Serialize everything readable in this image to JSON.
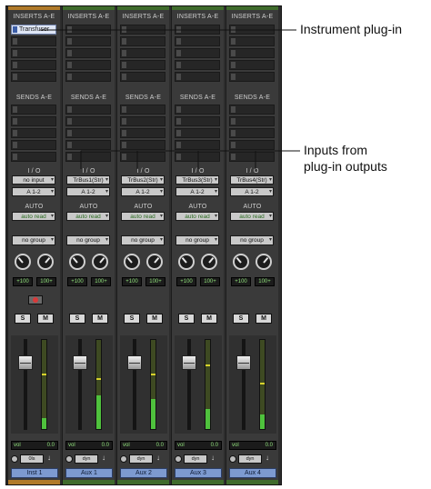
{
  "annotations": {
    "instrument": "Instrument plug-in",
    "inputs_line1": "Inputs from",
    "inputs_line2": "plug-in outputs"
  },
  "section_labels": {
    "inserts": "INSERTS A-E",
    "sends": "SENDS A-E",
    "io": "I / O",
    "auto": "AUTO",
    "vol": "vol"
  },
  "strips": [
    {
      "color": "#b07a2a",
      "insert": "Transfuser",
      "input": "no input",
      "output": "A 1-2",
      "auto": "auto read",
      "group": "no group",
      "pan_l": "+100",
      "pan_r": "100+",
      "rec": true,
      "solo": "S",
      "mute": "M",
      "vol": "0.0",
      "dyn": "0ls",
      "name": "Inst 1",
      "meter_level": 0.12,
      "peak": 0.6
    },
    {
      "color": "#3f6b2c",
      "insert": "",
      "input": "TrBus1(Str)",
      "output": "A 1-2",
      "auto": "auto read",
      "group": "no group",
      "pan_l": "+100",
      "pan_r": "100+",
      "rec": false,
      "solo": "S",
      "mute": "M",
      "vol": "0.0",
      "dyn": "dyn",
      "name": "Aux 1",
      "meter_level": 0.38,
      "peak": 0.55
    },
    {
      "color": "#3f6b2c",
      "insert": "",
      "input": "TrBus2(Str)",
      "output": "A 1-2",
      "auto": "auto read",
      "group": "no group",
      "pan_l": "+100",
      "pan_r": "100+",
      "rec": false,
      "solo": "S",
      "mute": "M",
      "vol": "0.0",
      "dyn": "dyn",
      "name": "Aux 2",
      "meter_level": 0.34,
      "peak": 0.6
    },
    {
      "color": "#3f6b2c",
      "insert": "",
      "input": "TrBus3(Str)",
      "output": "A 1-2",
      "auto": "auto read",
      "group": "no group",
      "pan_l": "+100",
      "pan_r": "100+",
      "rec": false,
      "solo": "S",
      "mute": "M",
      "vol": "0.0",
      "dyn": "dyn",
      "name": "Aux 3",
      "meter_level": 0.22,
      "peak": 0.7
    },
    {
      "color": "#3f6b2c",
      "insert": "",
      "input": "TrBus4(Str)",
      "output": "A 1-2",
      "auto": "auto read",
      "group": "no group",
      "pan_l": "+100",
      "pan_r": "100+",
      "rec": false,
      "solo": "S",
      "mute": "M",
      "vol": "0.0",
      "dyn": "dyn",
      "name": "Aux 4",
      "meter_level": 0.16,
      "peak": 0.5
    }
  ]
}
